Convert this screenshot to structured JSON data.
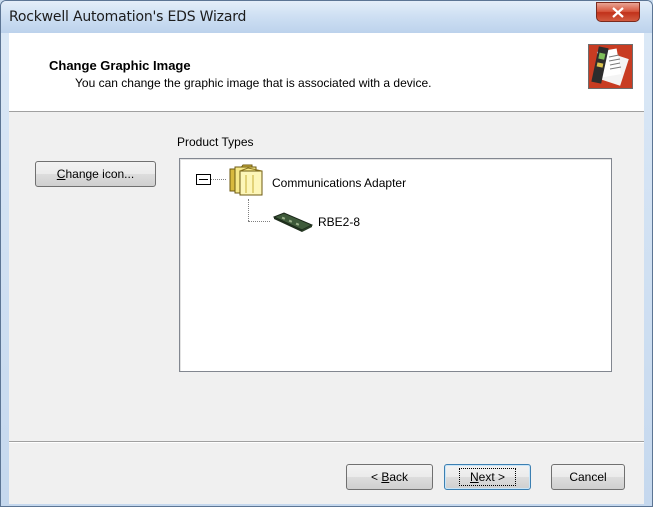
{
  "window": {
    "title": "Rockwell Automation's EDS Wizard",
    "close_icon": "close-icon"
  },
  "header": {
    "title": "Change Graphic Image",
    "subtitle": "You can change the graphic image that is associated with a device.",
    "icon": "wizard-graphic-icon"
  },
  "main": {
    "product_types_label": "Product Types",
    "change_icon_button": {
      "prefix": "C",
      "rest": "hange icon..."
    },
    "tree": {
      "root": {
        "label": "Communications Adapter",
        "icon": "folder-icon",
        "expanded": true
      },
      "children": [
        {
          "label": "RBE2-8",
          "icon": "device-module-icon"
        }
      ]
    }
  },
  "footer": {
    "back_button": {
      "prefix": "< ",
      "accel": "B",
      "rest": "ack"
    },
    "next_button": {
      "accel": "N",
      "rest": "ext >"
    },
    "cancel_button": "Cancel"
  },
  "colors": {
    "title_bar": "#cfe0f3",
    "close_button": "#c8432a",
    "dialog_bg": "#f0f0f0"
  }
}
